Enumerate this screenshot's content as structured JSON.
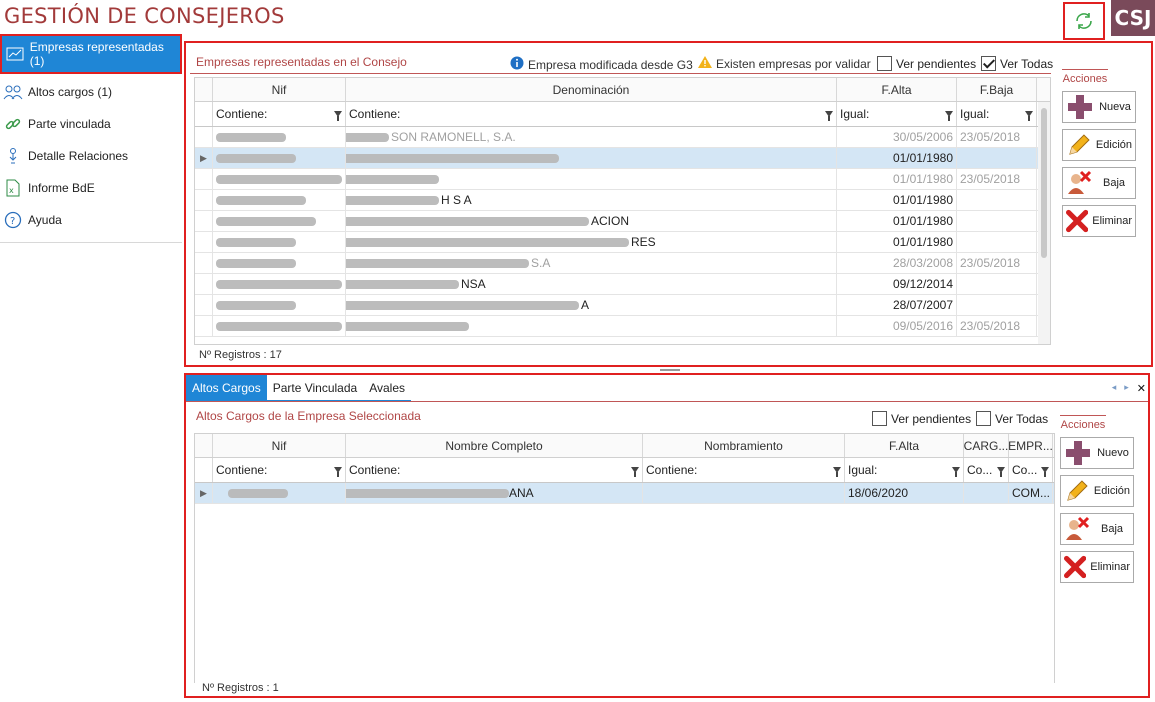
{
  "header": {
    "title": "GESTIÓN DE CONSEJEROS",
    "brand": "CSJ"
  },
  "sidebar": {
    "items": [
      {
        "label": "Empresas representadas (1)",
        "icon": "org-chart-icon"
      },
      {
        "label": "Altos cargos (1)",
        "icon": "people-icon"
      },
      {
        "label": "Parte vinculada",
        "icon": "link-icon"
      },
      {
        "label": "Detalle Relaciones",
        "icon": "relations-icon"
      },
      {
        "label": "Informe BdE",
        "icon": "excel-icon"
      },
      {
        "label": "Ayuda",
        "icon": "help-icon"
      }
    ]
  },
  "empresas": {
    "title": "Empresas representadas en el Consejo",
    "legend_modified": "Empresa modificada desde G3",
    "legend_pending": "Existen empresas por validar",
    "ver_pendientes": "Ver pendientes",
    "ver_todas": "Ver Todas",
    "ver_pendientes_checked": false,
    "ver_todas_checked": true,
    "columns": [
      "Nif",
      "Denominación",
      "F.Alta",
      "F.Baja"
    ],
    "filters": [
      "Contiene:",
      "Contiene:",
      "Igual:",
      "Igual:"
    ],
    "rows": [
      {
        "denom": "SON RAMONELL, S.A.",
        "alta": "30/05/2006",
        "baja": "23/05/2018",
        "dim": true,
        "selected": false
      },
      {
        "denom": "",
        "alta": "01/01/1980",
        "baja": "",
        "dim": false,
        "selected": true
      },
      {
        "denom": "",
        "alta": "01/01/1980",
        "baja": "23/05/2018",
        "dim": true,
        "selected": false
      },
      {
        "denom": "H S A",
        "alta": "01/01/1980",
        "baja": "",
        "dim": false,
        "selected": false
      },
      {
        "denom": "ACION",
        "alta": "01/01/1980",
        "baja": "",
        "dim": false,
        "selected": false
      },
      {
        "denom": "RES",
        "alta": "01/01/1980",
        "baja": "",
        "dim": false,
        "selected": false
      },
      {
        "denom": "S.A",
        "alta": "28/03/2008",
        "baja": "23/05/2018",
        "dim": true,
        "selected": false
      },
      {
        "denom": "NSA",
        "alta": "09/12/2014",
        "baja": "",
        "dim": false,
        "selected": false
      },
      {
        "denom": "A",
        "alta": "28/07/2007",
        "baja": "",
        "dim": false,
        "selected": false
      },
      {
        "denom": "",
        "alta": "09/05/2016",
        "baja": "23/05/2018",
        "dim": true,
        "selected": false
      }
    ],
    "count": "Nº Registros : 17"
  },
  "actions_top": {
    "title": "Acciones",
    "buttons": [
      "Nueva",
      "Edición",
      "Baja",
      "Eliminar"
    ]
  },
  "tabs": [
    "Altos Cargos",
    "Parte Vinculada",
    "Avales"
  ],
  "altos": {
    "title": "Altos Cargos de la Empresa Seleccionada",
    "ver_pendientes": "Ver pendientes",
    "ver_todas": "Ver Todas",
    "columns": [
      "Nif",
      "Nombre Completo",
      "Nombramiento",
      "F.Alta",
      "CARG...",
      "EMPR..."
    ],
    "filters": [
      "Contiene:",
      "Contiene:",
      "Contiene:",
      "Igual:",
      "Co...",
      "Co..."
    ],
    "rows": [
      {
        "nombre": "ANA",
        "alta": "18/06/2020",
        "empr": "COM..."
      }
    ],
    "count": "Nº Registros : 1"
  },
  "actions_bottom": {
    "title": "Acciones",
    "buttons": [
      "Nuevo",
      "Edición",
      "Baja",
      "Eliminar"
    ]
  },
  "colors": {
    "accent": "#1f86d6",
    "title": "#a23a3a",
    "highlight": "#e02020",
    "selected_row": "#d4e6f5"
  }
}
